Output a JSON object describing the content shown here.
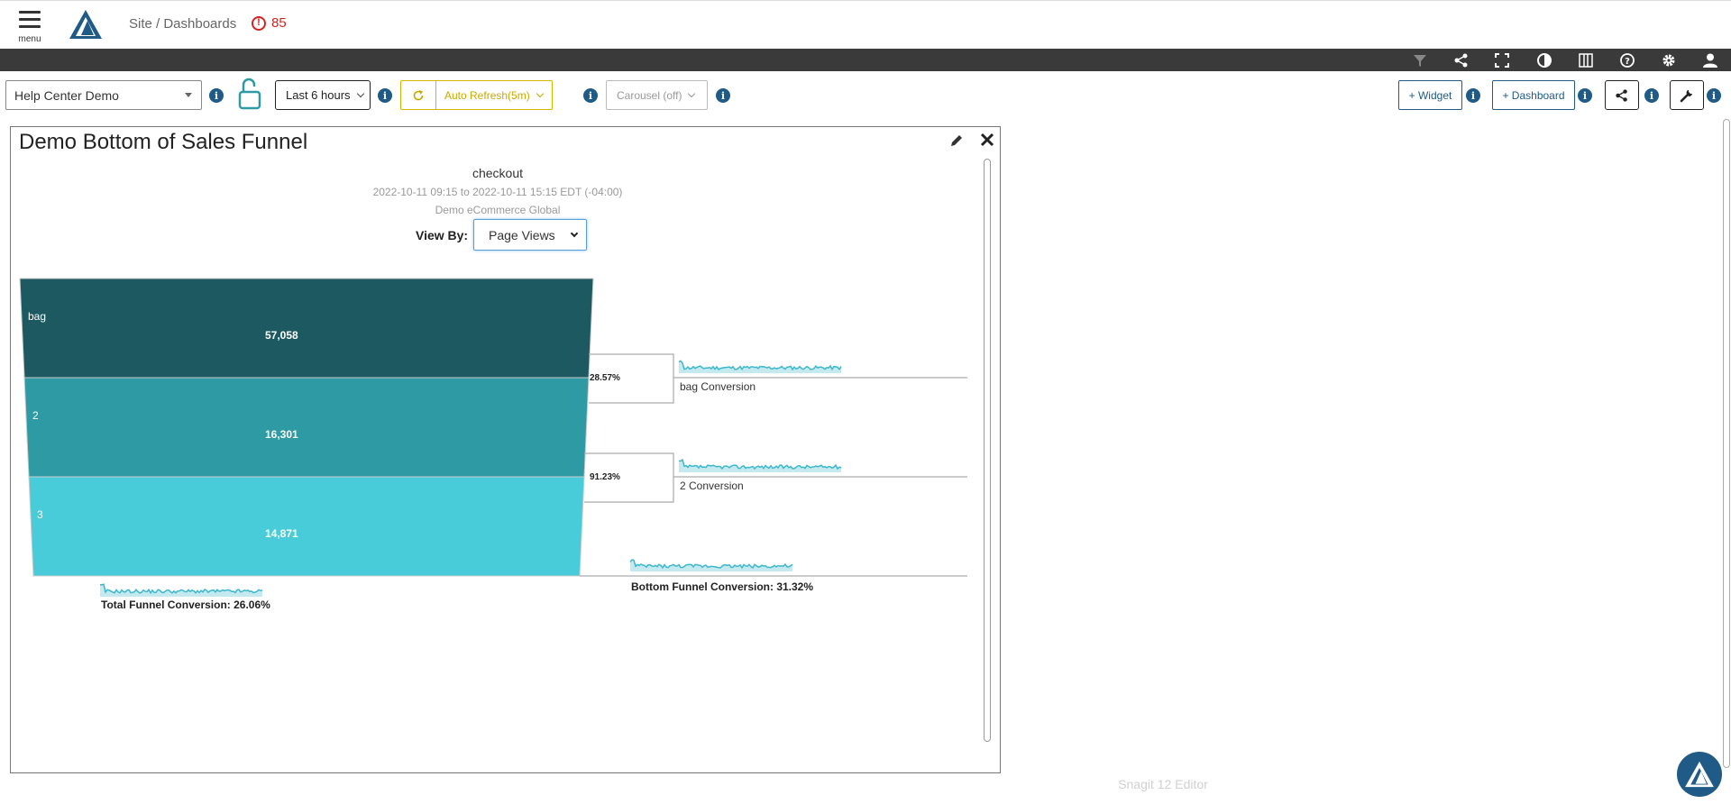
{
  "nav": {
    "menu_label": "menu",
    "breadcrumb": "Site / Dashboards",
    "alert_count": "85"
  },
  "toolbar_icons": [
    "filter-icon",
    "share-icon",
    "fullscreen-icon",
    "contrast-icon",
    "columns-icon",
    "help-icon",
    "gear-icon",
    "user-icon"
  ],
  "controls": {
    "site": "Help Center Demo",
    "time_range": "Last 6 hours",
    "auto_refresh": "Auto Refresh(5m)",
    "carousel": "Carousel (off)",
    "add_widget": "+ Widget",
    "add_dashboard": "+ Dashboard"
  },
  "widget": {
    "title": "Demo Bottom of Sales Funnel",
    "funnel_name": "checkout",
    "range": "2022-10-11 09:15 to 2022-10-11 15:15 EDT (-04:00)",
    "site": "Demo eCommerce Global",
    "view_by_label": "View By:",
    "view_by_value": "Page Views"
  },
  "funnel": {
    "stages": [
      {
        "name": "bag",
        "value": "57,058",
        "color": "#1d5961"
      },
      {
        "name": "2",
        "value": "16,301",
        "color": "#2e9aa3"
      },
      {
        "name": "3",
        "value": "14,871",
        "color": "#48ccd9"
      }
    ],
    "step_conversions": [
      {
        "pct": "28.57%",
        "label": "bag Conversion"
      },
      {
        "pct": "91.23%",
        "label": "2 Conversion"
      }
    ],
    "total_conversion": "Total Funnel Conversion: 26.06%",
    "bottom_conversion": "Bottom Funnel Conversion: 31.32%",
    "sparkline_color": "#3bb8cc"
  },
  "footer": {
    "watermark": "Snagit 12 Editor"
  }
}
